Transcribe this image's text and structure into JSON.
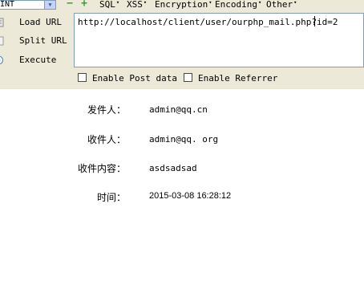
{
  "toolbar": {
    "select_value": "INT",
    "menus": [
      {
        "label": "SQL"
      },
      {
        "label": "XSS"
      },
      {
        "label": "Encryption"
      },
      {
        "label": "Encoding"
      },
      {
        "label": "Other"
      }
    ]
  },
  "actions": {
    "load_label": "Load URL",
    "split_label": "Split URL",
    "execute_label": "Execute"
  },
  "url": {
    "value": "http://localhost/client/user/ourphp_mail.php?id=2"
  },
  "options": {
    "post_label": "Enable Post data",
    "referrer_label": "Enable Referrer"
  },
  "mail": {
    "sender_label": "发件人：",
    "sender_value": "admin@qq.cn",
    "receiver_label": "收件人：",
    "receiver_value": "admin@qq.  org",
    "content_label": "收件内容：",
    "content_value": "asdsadsad",
    "time_label": "时间：",
    "time_value": "2015-03-08 16:28:12"
  },
  "colors": {
    "toolbar_bg": "#ece9d8",
    "border": "#7f9db9",
    "icon_green": "#2ea52e"
  }
}
